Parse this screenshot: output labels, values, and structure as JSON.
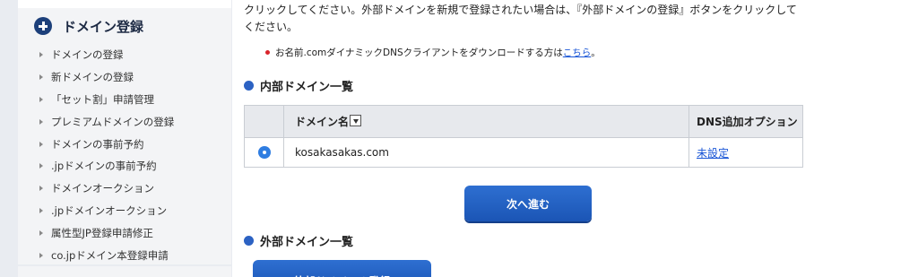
{
  "sidebar": {
    "title": "ドメイン登録",
    "items": [
      {
        "label": "ドメインの登録"
      },
      {
        "label": "新ドメインの登録"
      },
      {
        "label": "「セット割」申請管理"
      },
      {
        "label": "プレミアムドメインの登録"
      },
      {
        "label": "ドメインの事前予約"
      },
      {
        "label": ".jpドメインの事前予約"
      },
      {
        "label": "ドメインオークション"
      },
      {
        "label": ".jpドメインオークション"
      },
      {
        "label": "属性型JP登録申請修正"
      },
      {
        "label": "co.jpドメイン本登録申請"
      }
    ]
  },
  "main": {
    "intro_text": "クリックしてください。外部ドメインを新規で登録されたい場合は、『外部ドメインの登録』ボタンをクリックしてください。",
    "note_prefix": "お名前.comダイナミックDNSクライアントをダウンロードする方は",
    "note_link": "こちら",
    "note_suffix": "。",
    "internal_title": "内部ドメイン一覧",
    "table": {
      "col_domain": "ドメイン名",
      "col_option": "DNS追加オプション",
      "rows": [
        {
          "domain": "kosakasakas.com",
          "option": "未設定",
          "selected": true
        }
      ]
    },
    "next_button": "次へ進む",
    "external_title": "外部ドメイン一覧",
    "external_button": "外部ドメインの登録"
  },
  "colors": {
    "accent": "#2c62c3",
    "button": "#1b55b5",
    "link": "#1a56d6",
    "note_dot": "#d9242b",
    "sidebar_icon": "#1c3f7a"
  }
}
